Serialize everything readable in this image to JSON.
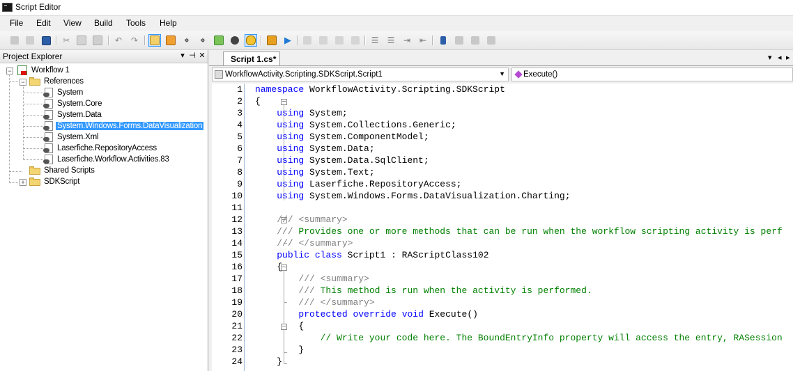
{
  "window": {
    "title": "Script Editor"
  },
  "menu": [
    "File",
    "Edit",
    "View",
    "Build",
    "Tools",
    "Help"
  ],
  "project_explorer": {
    "title": "Project Explorer",
    "buttons": {
      "pin": "▾",
      "dock": "⊣",
      "close": "✕"
    },
    "tree": {
      "root": "Workflow 1",
      "references_label": "References",
      "references": [
        "System",
        "System.Core",
        "System.Data",
        "System.Windows.Forms.DataVisualization",
        "System.Xml",
        "Laserfiche.RepositoryAccess",
        "Laserfiche.Workflow.Activities.83"
      ],
      "selected_reference": "System.Windows.Forms.DataVisualization",
      "shared_scripts": "Shared Scripts",
      "sdkscript": "SDKScript"
    }
  },
  "editor": {
    "tab_label": "Script 1.cs*",
    "class_combo": "WorkflowActivity.Scripting.SDKScript.Script1",
    "member_combo": "Execute()",
    "lines": [
      {
        "n": "1",
        "t": "namespace WorkflowActivity.Scripting.SDKScript"
      },
      {
        "n": "2",
        "t": "{"
      },
      {
        "n": "3",
        "t": "    using System;"
      },
      {
        "n": "4",
        "t": "    using System.Collections.Generic;"
      },
      {
        "n": "5",
        "t": "    using System.ComponentModel;"
      },
      {
        "n": "6",
        "t": "    using System.Data;"
      },
      {
        "n": "7",
        "t": "    using System.Data.SqlClient;"
      },
      {
        "n": "8",
        "t": "    using System.Text;"
      },
      {
        "n": "9",
        "t": "    using Laserfiche.RepositoryAccess;"
      },
      {
        "n": "10",
        "t": "    using System.Windows.Forms.DataVisualization.Charting;"
      },
      {
        "n": "11",
        "t": ""
      },
      {
        "n": "12",
        "t": "    /// <summary>"
      },
      {
        "n": "13",
        "t": "    /// Provides one or more methods that can be run when the workflow scripting activity is perf"
      },
      {
        "n": "14",
        "t": "    /// </summary>"
      },
      {
        "n": "15",
        "t": "    public class Script1 : RAScriptClass102"
      },
      {
        "n": "16",
        "t": "    {"
      },
      {
        "n": "17",
        "t": "        /// <summary>"
      },
      {
        "n": "18",
        "t": "        /// This method is run when the activity is performed."
      },
      {
        "n": "19",
        "t": "        /// </summary>"
      },
      {
        "n": "20",
        "t": "        protected override void Execute()"
      },
      {
        "n": "21",
        "t": "        {"
      },
      {
        "n": "22",
        "t": "            // Write your code here. The BoundEntryInfo property will access the entry, RASession"
      },
      {
        "n": "23",
        "t": "        }"
      },
      {
        "n": "24",
        "t": "    }"
      }
    ]
  }
}
